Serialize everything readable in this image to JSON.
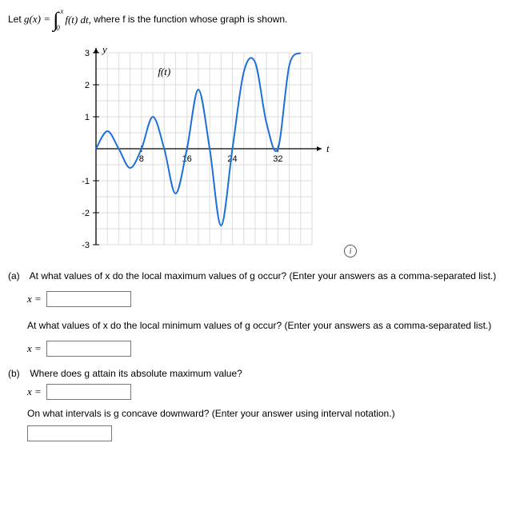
{
  "statement": {
    "prefix": "Let ",
    "gx": "g(x) = ",
    "upper": "x",
    "lower": "0",
    "integrand": "f(t) dt,",
    "suffix": " where f is the function whose graph is shown."
  },
  "chart_data": {
    "type": "line",
    "title": "",
    "xlabel": "t",
    "ylabel": "y",
    "curve_label": "f(t)",
    "xlim": [
      0,
      38
    ],
    "ylim": [
      -3,
      3
    ],
    "xticks": [
      8,
      16,
      24,
      32
    ],
    "yticks": [
      -3,
      -2,
      -1,
      1,
      2,
      3
    ],
    "series": [
      {
        "name": "f(t)",
        "x": [
          0,
          2,
          4,
          6,
          8,
          10,
          12,
          14,
          16,
          18,
          20,
          22,
          24,
          26,
          28,
          30,
          32,
          34,
          36
        ],
        "y": [
          0,
          0.55,
          0.0,
          -0.6,
          0.0,
          1.0,
          0.0,
          -1.4,
          0.0,
          1.85,
          0.0,
          -2.4,
          0.0,
          2.4,
          2.7,
          0.8,
          0.0,
          2.6,
          3.0
        ]
      }
    ]
  },
  "qa": {
    "part_a_label": "(a)",
    "q1": "At what values of x do the local maximum values of g occur? (Enter your answers as a comma-separated list.)",
    "q1_var": "x =",
    "q1_ans": "",
    "q2": "At what values of x do the local minimum values of g occur? (Enter your answers as a comma-separated list.)",
    "q2_var": "x =",
    "q2_ans": "",
    "part_b_label": "(b)",
    "q3": "Where does g attain its absolute maximum value?",
    "q3_var": "x =",
    "q3_ans": "",
    "q4": "On what intervals is g concave downward? (Enter your answer using interval notation.)",
    "q4_ans": ""
  }
}
